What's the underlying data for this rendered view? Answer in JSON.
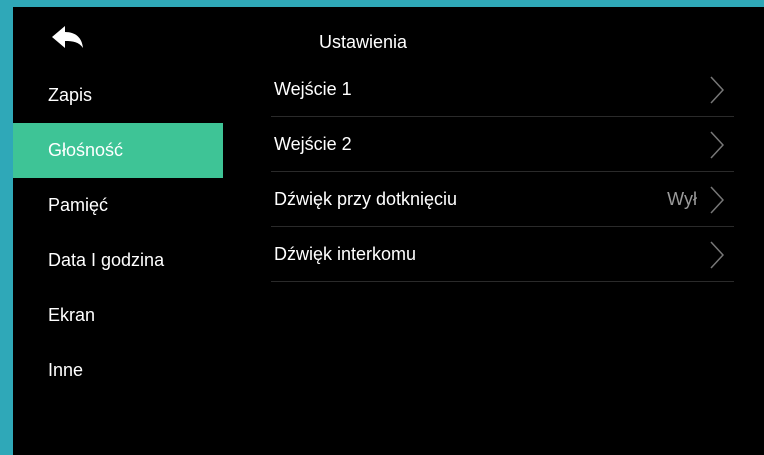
{
  "header": {
    "title": "Ustawienia",
    "back_icon": "back-arrow-icon"
  },
  "sidebar": {
    "active_color": "#3ec496",
    "items": [
      {
        "label": "Zapis"
      },
      {
        "label": "Głośność",
        "active": true
      },
      {
        "label": "Pamięć"
      },
      {
        "label": "Data I godzina"
      },
      {
        "label": "Ekran"
      },
      {
        "label": "Inne"
      }
    ]
  },
  "main": {
    "rows": [
      {
        "label": "Wejście 1",
        "value": "",
        "icon": "chevron-right-icon"
      },
      {
        "label": "Wejście 2",
        "value": "",
        "icon": "chevron-right-icon"
      },
      {
        "label": "Dźwięk przy dotknięciu",
        "value": "Wył",
        "icon": "chevron-right-icon"
      },
      {
        "label": "Dźwięk interkomu",
        "value": "",
        "icon": "chevron-right-icon"
      }
    ]
  },
  "colors": {
    "frame": "#2fa8b8",
    "background": "#000000",
    "text": "#ffffff",
    "value_text": "#9a9a9a"
  }
}
